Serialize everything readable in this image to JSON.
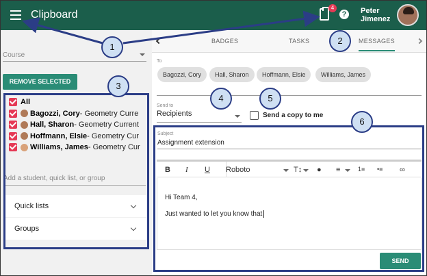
{
  "app": {
    "title": "Clipboard",
    "notification_count": "4",
    "help_glyph": "?",
    "user_first": "Peter",
    "user_last": "Jimenez"
  },
  "sidebar": {
    "course_placeholder": "Course",
    "remove_label": "REMOVE SELECTED",
    "recipients": [
      {
        "name": "All",
        "course": ""
      },
      {
        "name": "Bagozzi, Cory",
        "course": " - Geometry Curre"
      },
      {
        "name": "Hall, Sharon",
        "course": " - Geometry Current"
      },
      {
        "name": "Hoffmann, Elsie",
        "course": " - Geometry Cur"
      },
      {
        "name": "Williams, James",
        "course": " - Geometry Cur"
      }
    ],
    "add_placeholder": "Add a student, quick list, or group",
    "quick_lists_label": "Quick lists",
    "groups_label": "Groups"
  },
  "tabs": {
    "badges": "BADGES",
    "tasks": "TASKS",
    "messages": "MESSAGES"
  },
  "compose": {
    "to_label": "To",
    "chips": [
      "Bagozzi, Cory",
      "Hall, Sharon",
      "Hoffmann, Elsie",
      "Williams, James"
    ],
    "send_to_label": "Send to",
    "send_to_value": "Recipients",
    "copy_label": "Send a copy to me",
    "subject_label": "Subject",
    "subject_value": "Assignment extension",
    "font_name": "Roboto",
    "body_line1": "Hi Team 4,",
    "body_line2": "Just wanted to let you know that",
    "send_label": "SEND"
  },
  "callouts": [
    "1",
    "2",
    "3",
    "4",
    "5",
    "6"
  ],
  "colors": {
    "topbar": "#1b5e4b",
    "accent": "#2a8c76",
    "badge": "#e53955",
    "annotation": "#2b3d86"
  }
}
